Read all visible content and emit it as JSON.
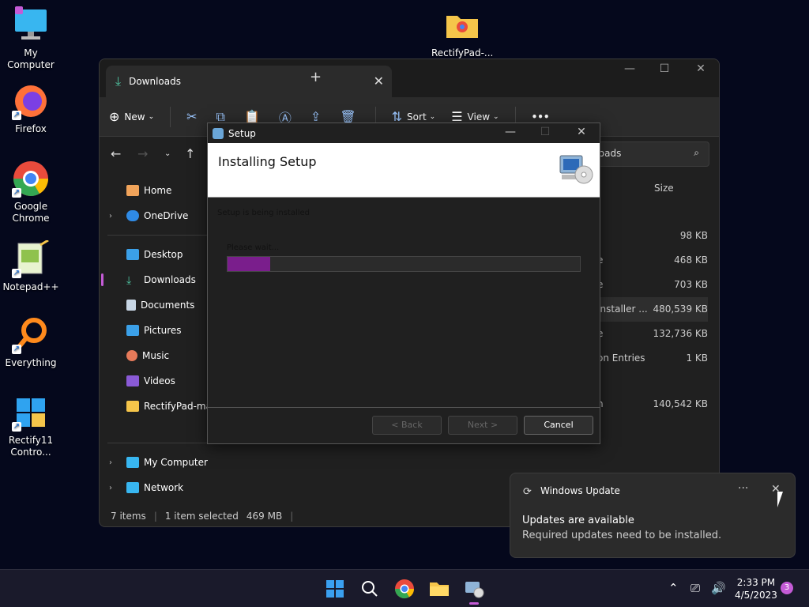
{
  "desktop": {
    "icons": [
      {
        "label": "My Computer"
      },
      {
        "label": "RectifyPad-..."
      },
      {
        "label": "Firefox"
      },
      {
        "label": "Google Chrome"
      },
      {
        "label": "Notepad++"
      },
      {
        "label": "Everything"
      },
      {
        "label": "Rectify11 Contro..."
      }
    ]
  },
  "explorer": {
    "tab_title": "Downloads",
    "toolbar": {
      "new_label": "New",
      "sort_label": "Sort",
      "view_label": "View",
      "more": "•••"
    },
    "search_placeholder": "wnloads",
    "column_size": "Size",
    "sidebar": {
      "home": "Home",
      "onedrive": "OneDrive",
      "desktop": "Desktop",
      "downloads": "Downloads",
      "documents": "Documents",
      "pictures": "Pictures",
      "music": "Music",
      "videos": "Videos",
      "rectifypad": "RectifyPad-mai",
      "mycomputer": "My Computer",
      "network": "Network"
    },
    "files": [
      {
        "name": "",
        "size": "98 KB"
      },
      {
        "name": "e",
        "size": "468 KB"
      },
      {
        "name": "e",
        "size": "703 KB"
      },
      {
        "name": "Installer ...",
        "size": "480,539 KB"
      },
      {
        "name": "e",
        "size": "132,736 KB"
      },
      {
        "name": "on Entries",
        "size": "1 KB"
      },
      {
        "name": "n",
        "size": "140,542 KB"
      }
    ],
    "status": {
      "items": "7 items",
      "selected": "1 item selected",
      "size": "469 MB"
    }
  },
  "setup": {
    "title": "Setup",
    "header_title": "Installing Setup",
    "status_text": "Setup is being installed",
    "wait_text": "Please wait...",
    "progress": 0.12,
    "buttons": {
      "back": "< Back",
      "next": "Next >",
      "cancel": "Cancel"
    }
  },
  "toast": {
    "app": "Windows Update",
    "more": "···",
    "title": "Updates are available",
    "body": "Required updates need to be installed."
  },
  "taskbar": {
    "time": "2:33 PM",
    "date": "4/5/2023",
    "notification_count": "3"
  },
  "colors": {
    "accent": "#c45bd6",
    "progress": "#7a1e8c",
    "background": "#05081c"
  }
}
